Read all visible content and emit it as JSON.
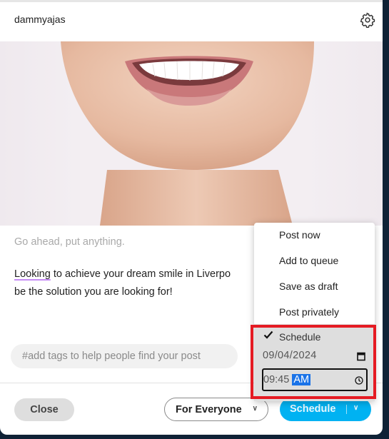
{
  "header": {
    "username": "dammyajas",
    "settings_icon": "gear-icon"
  },
  "photo": {
    "alt": "close-up of smiling mouth with white teeth"
  },
  "composer": {
    "placeholder": "Go ahead, put anything.",
    "caption_first_word": "Looking",
    "caption_rest_line1": " to achieve your dream smile in Liverpo",
    "caption_line2": "be the solution you are looking for!",
    "tags_placeholder": "#add tags to help people find your post"
  },
  "footer": {
    "close_label": "Close",
    "audience_label": "For Everyone",
    "audience_chevron": "⌄",
    "schedule_label": "Schedule",
    "schedule_chevron": "⌄"
  },
  "post_menu": {
    "items": [
      {
        "label": "Post now"
      },
      {
        "label": "Add to queue"
      },
      {
        "label": "Save as draft"
      },
      {
        "label": "Post privately"
      }
    ],
    "schedule": {
      "label": "Schedule",
      "checked": true,
      "date": "09/04/2024",
      "time": "09:45",
      "ampm": "AM"
    }
  },
  "colors": {
    "accent": "#00b2f2",
    "highlight_border": "#e51b23",
    "spellcheck_underline": "#c68cf5",
    "background": "#0f2236"
  }
}
